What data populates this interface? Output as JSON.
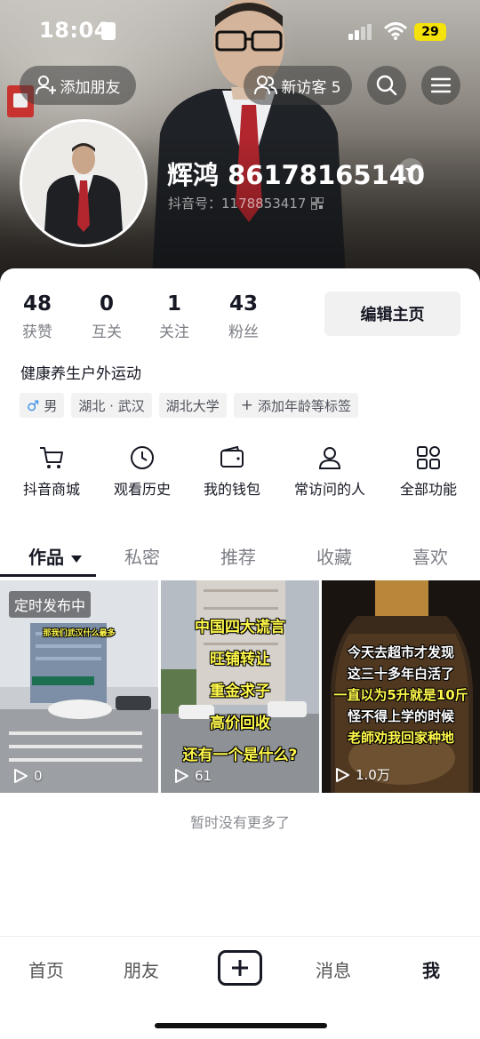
{
  "status": {
    "time": "18:04",
    "battery": "29"
  },
  "header": {
    "add_friend": "添加朋友",
    "new_visitors": "新访客 5",
    "name": "辉鸿 86178165140",
    "douyin_id": "抖音号：1178853417"
  },
  "stats": [
    {
      "num": "48",
      "label": "获赞"
    },
    {
      "num": "0",
      "label": "互关"
    },
    {
      "num": "1",
      "label": "关注"
    },
    {
      "num": "43",
      "label": "粉丝"
    }
  ],
  "edit_profile": "编辑主页",
  "bio": "健康养生户外运动",
  "tags": {
    "gender": "男",
    "location": "湖北 · 武汉",
    "school": "湖北大学",
    "add": "添加年龄等标签"
  },
  "functions": [
    "抖音商城",
    "观看历史",
    "我的钱包",
    "常访问的人",
    "全部功能"
  ],
  "tabs": [
    "作品",
    "私密",
    "推荐",
    "收藏",
    "喜欢"
  ],
  "videos": [
    {
      "badge": "定时发布中",
      "caption_top": "那我们武汉什么最多",
      "plays": "0"
    },
    {
      "lines": [
        "中国四大谎言",
        "旺铺转让",
        "重金求子",
        "高价回收",
        "还有一个是什么?"
      ],
      "plays": "61"
    },
    {
      "lines": [
        "今天去超市才发现",
        "这三十多年白活了",
        "一直以为5升就是10斤",
        "怪不得上学的时候",
        "老師劝我回家种地"
      ],
      "plays": "1.0万"
    }
  ],
  "no_more": "暂时没有更多了",
  "nav": {
    "home": "首页",
    "friends": "朋友",
    "messages": "消息",
    "me": "我"
  },
  "colors": {
    "battery": "#f5e20a",
    "caption_yellow": "#fff84b"
  }
}
